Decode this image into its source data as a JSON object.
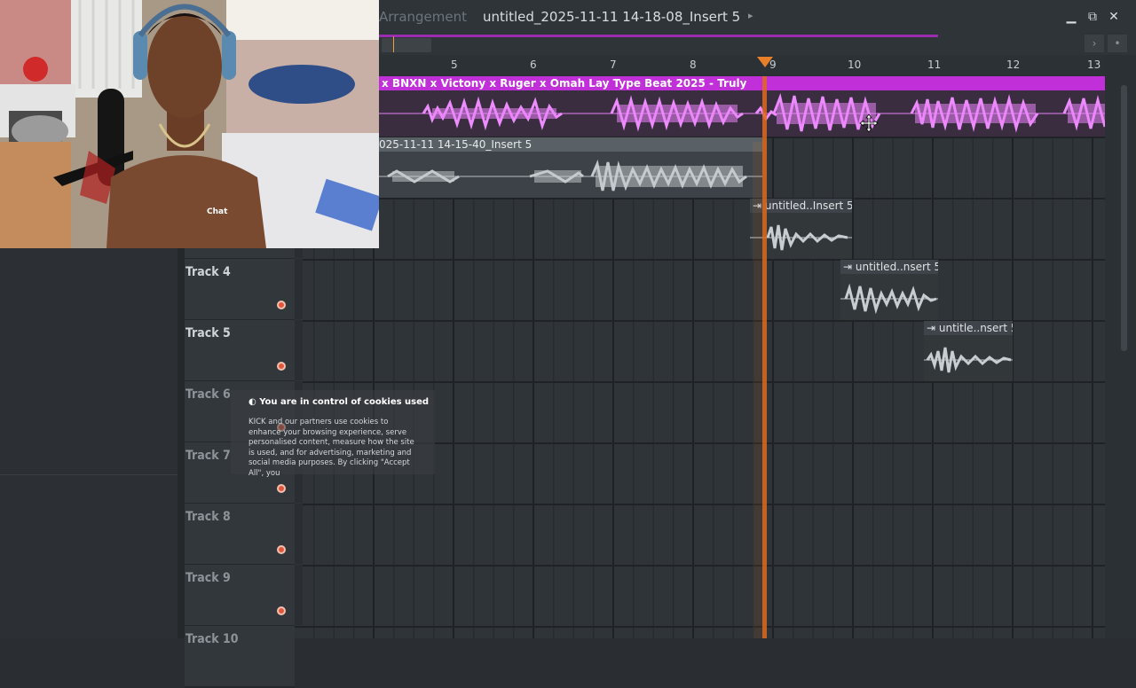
{
  "window": {
    "section": "Arrangement",
    "title": "untitled_2025-11-11 14-18-08_Insert 5",
    "caret": "▸",
    "minimize": "▁",
    "restore": "⧉",
    "close": "✕"
  },
  "timeline": {
    "bars": [
      "5",
      "6",
      "7",
      "8",
      "9",
      "10",
      "11",
      "12",
      "13"
    ],
    "accent_color": "#e8802a"
  },
  "tracks": [
    {
      "label": "Track 4"
    },
    {
      "label": "Track 5"
    },
    {
      "label": "Track 6"
    },
    {
      "label": "Track 7"
    },
    {
      "label": "Track 8"
    },
    {
      "label": "Track 9"
    },
    {
      "label": "Track 10"
    }
  ],
  "clips": {
    "beat": "x BNXN x Victony x Ruger x Omah Lay Type Beat 2025 - Truly",
    "vocal_take": "025-11-11 14-15-40_Insert 5",
    "clip_a": "untitled..Insert 5",
    "clip_b": "untitled..nsert 5",
    "clip_c": "untitle..nsert 5",
    "clip_icon": "⇥",
    "pink_color": "#c12fd8",
    "grey_color": "#5a6166"
  },
  "overlay": {
    "chat_label": "Chat",
    "cookie_title": "You are in control of cookies used",
    "cookie_icon": "cookie-icon",
    "cookie_text": "KICK and our partners use cookies to enhance your browsing experience, serve personalised content, measure how the site is used, and for advertising, marketing and social media purposes. By clicking \"Accept All\", you"
  }
}
